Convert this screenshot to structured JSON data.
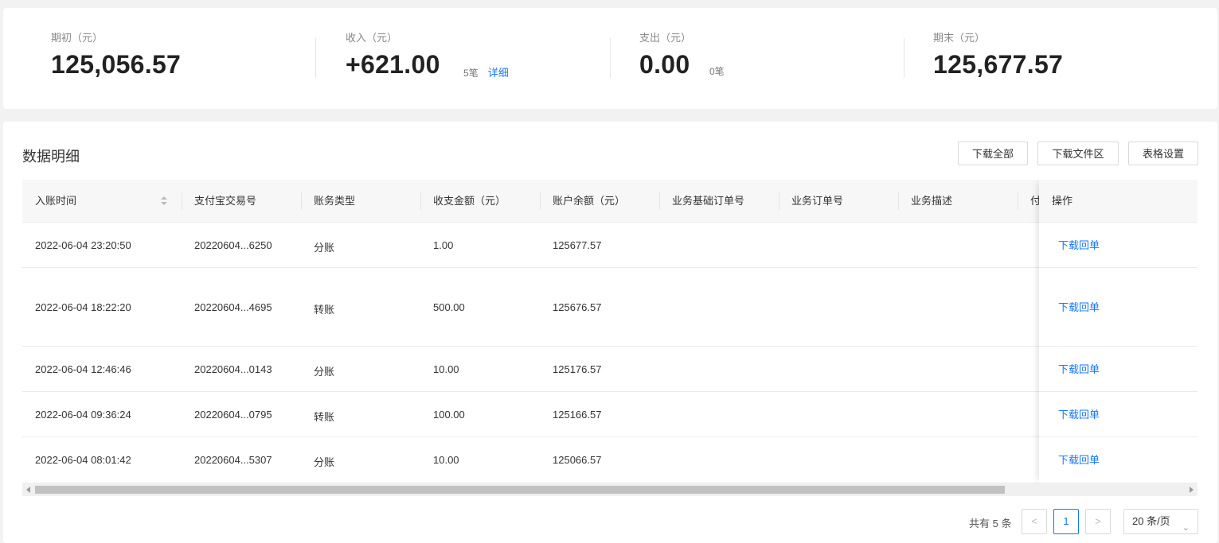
{
  "summary": {
    "opening": {
      "label": "期初（元）",
      "value": "125,056.57"
    },
    "income": {
      "label": "收入（元）",
      "value": "+621.00",
      "count": "5笔",
      "link": "详细"
    },
    "expense": {
      "label": "支出（元）",
      "value": "0.00",
      "count": "0笔"
    },
    "closing": {
      "label": "期末（元）",
      "value": "125,677.57"
    }
  },
  "detail": {
    "title": "数据明细",
    "buttons": {
      "download_all": "下载全部",
      "download_area": "下载文件区",
      "table_settings": "表格设置"
    }
  },
  "table": {
    "columns": [
      "入账时间",
      "支付宝交易号",
      "账务类型",
      "收支金额（元）",
      "账户余额（元）",
      "业务基础订单号",
      "业务订单号",
      "业务描述",
      "付"
    ],
    "action_header": "操作",
    "rows": [
      {
        "time": "2022-06-04 23:20:50",
        "trade_no": "20220604...6250",
        "type": "分账",
        "amount": "1.00",
        "balance": "125677.57",
        "action": "下载回单"
      },
      {
        "time": "2022-06-04 18:22:20",
        "trade_no": "20220604...4695",
        "type": "转账",
        "amount": "500.00",
        "balance": "125676.57",
        "action": "下载回单"
      },
      {
        "time": "2022-06-04 12:46:46",
        "trade_no": "20220604...0143",
        "type": "分账",
        "amount": "10.00",
        "balance": "125176.57",
        "action": "下载回单"
      },
      {
        "time": "2022-06-04 09:36:24",
        "trade_no": "20220604...0795",
        "type": "转账",
        "amount": "100.00",
        "balance": "125166.57",
        "action": "下载回单"
      },
      {
        "time": "2022-06-04 08:01:42",
        "trade_no": "20220604...5307",
        "type": "分账",
        "amount": "10.00",
        "balance": "125066.57",
        "action": "下载回单"
      }
    ]
  },
  "pagination": {
    "total": "共有 5 条",
    "prev": "<",
    "current": "1",
    "next": ">",
    "page_size": "20 条/页"
  },
  "colors": {
    "accent": "#1677ff"
  }
}
